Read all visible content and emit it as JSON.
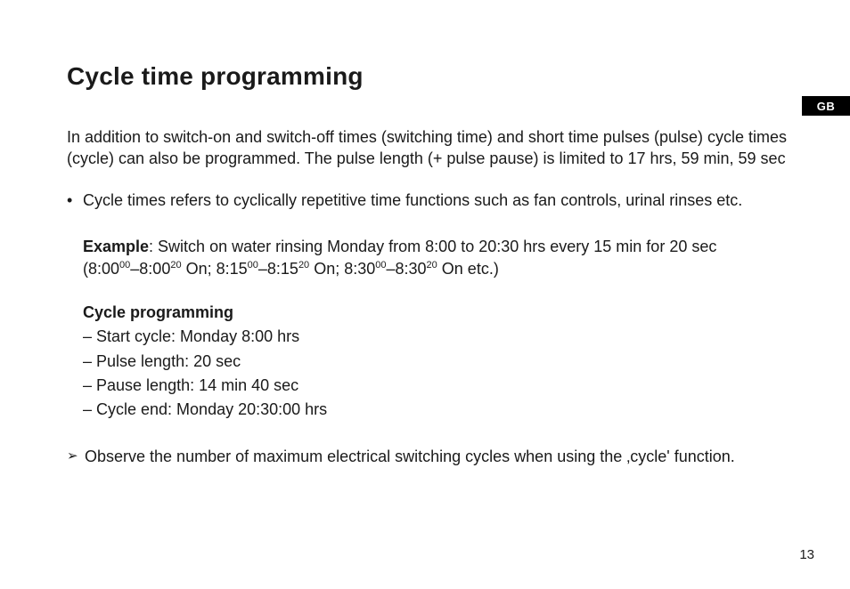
{
  "title": "Cycle time programming",
  "langTab": "GB",
  "intro": "In addition to switch-on and switch-off times (switching time) and short time pulses (pulse) cycle times (cycle) can also be programmed. The pulse length (+ pulse pause) is limited to 17 hrs, 59 min, 59 sec",
  "bulletMark": "•",
  "bulletText": "Cycle times refers to cyclically repetitive time functions such as fan controls, urinal rinses etc.",
  "exampleLabel": "Example",
  "exampleText": ": Switch on water rinsing Monday from 8:00 to 20:30 hrs every 15 min for 20 sec",
  "seq": {
    "a1": "(8:00",
    "a1s": "00",
    "a2": "–8:00",
    "a2s": "20",
    "a3": " On; 8:15",
    "b1s": "00",
    "b2": "–8:15",
    "b2s": "20",
    "b3": " On; 8:30",
    "c1s": "00",
    "c2": "–8:30",
    "c2s": "20",
    "c3": " On etc.)"
  },
  "cycleHeading": "Cycle programming",
  "cycleItems": [
    "– Start cycle: Monday 8:00 hrs",
    "– Pulse length: 20 sec",
    "– Pause length: 14 min 40 sec",
    "– Cycle end: Monday 20:30:00 hrs"
  ],
  "noteMark": "➢",
  "noteText": "Observe the number of maximum electrical switching cycles when using the ‚cycle' function.",
  "pageNumber": "13"
}
